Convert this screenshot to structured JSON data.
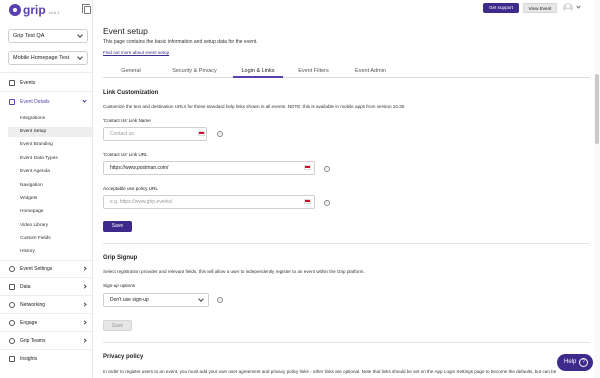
{
  "app": {
    "logo": "grip",
    "version": "v3.6.1"
  },
  "sidebar": {
    "event_selector": "Grip Test QA",
    "page_selector": "Mobile Homepage Test",
    "items": [
      {
        "label": "Events",
        "icon": "calendar-icon"
      },
      {
        "label": "Event Details",
        "icon": "calendar-icon"
      },
      {
        "label": "Event Settings",
        "icon": "gear-icon"
      },
      {
        "label": "Data",
        "icon": "grid-icon"
      },
      {
        "label": "Networking",
        "icon": "network-icon"
      },
      {
        "label": "Engage",
        "icon": "target-icon"
      },
      {
        "label": "Grip Teams",
        "icon": "teams-icon"
      },
      {
        "label": "Insights",
        "icon": "chart-icon"
      }
    ],
    "sub_items": [
      "Integrations",
      "Event Setup",
      "Event Branding",
      "Event Data Types",
      "Event Agenda",
      "Navigation",
      "Widgets",
      "Homepage",
      "Video Library",
      "Custom Fields",
      "History"
    ]
  },
  "topbar": {
    "support": "Get support",
    "view_event": "View Event"
  },
  "page": {
    "title": "Event setup",
    "description": "This page contains the basic information and setup data for the event.",
    "link": "Find out more about event setup"
  },
  "tabs": [
    "General",
    "Security & Privacy",
    "Login & Links",
    "Event Filters",
    "Event Admin"
  ],
  "link_customization": {
    "title": "Link Customization",
    "description": "Customize the text and destination URLs for these standard help links shown in all events. NOTE: this is available in mobile apps from version 10.30.",
    "contact_name_label": "'Contact Us' Link Name",
    "contact_name_placeholder": "Contact us",
    "contact_url_label": "'Contact Us' Link URL",
    "contact_url_value": "https://www.postman.com/",
    "policy_label": "Acceptable use policy URL",
    "policy_placeholder": "e.g. https://www.grip.events/",
    "save": "Save"
  },
  "grip_signup": {
    "title": "Grip Signup",
    "description": "Select registration provider and relevant fields, this will allow a user to independently register to an event within the Grip platform.",
    "options_label": "Sign-up options",
    "options_value": "Don't use sign-up",
    "save": "Save"
  },
  "privacy": {
    "title": "Privacy policy",
    "description": "In order to register users to an event, you must add your own user agreement and privacy policy links - other links are optional. Note that links should be set on the App Login Settings page to become the defaults, but can be"
  },
  "help": "Help"
}
